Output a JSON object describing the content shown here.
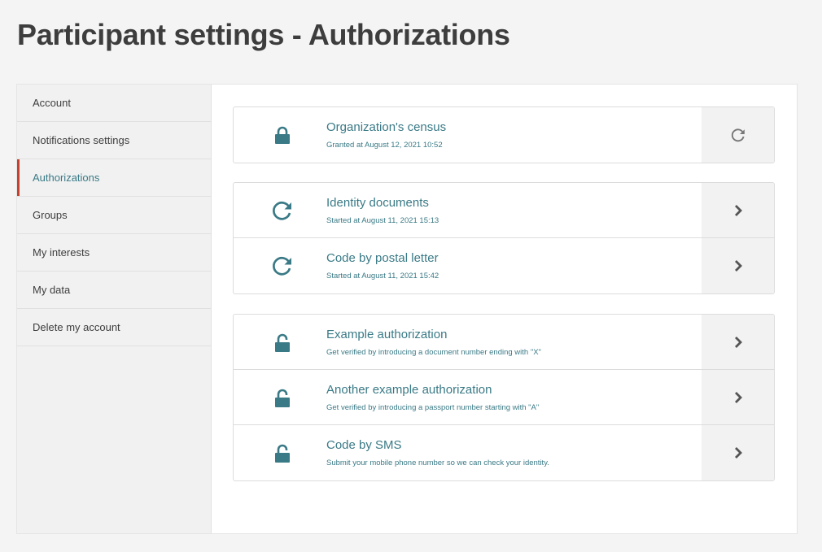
{
  "page": {
    "title": "Participant settings - Authorizations"
  },
  "sidebar": {
    "items": [
      {
        "label": "Account"
      },
      {
        "label": "Notifications settings"
      },
      {
        "label": "Authorizations",
        "active": true
      },
      {
        "label": "Groups"
      },
      {
        "label": "My interests"
      },
      {
        "label": "My data"
      },
      {
        "label": "Delete my account"
      }
    ]
  },
  "granted": [
    {
      "icon": "lock-closed-icon",
      "title": "Organization's census",
      "subtitle": "Granted at August 12, 2021 10:52",
      "action_icon": "refresh-icon"
    }
  ],
  "pending": [
    {
      "icon": "refresh-icon",
      "title": "Identity documents",
      "subtitle": "Started at August 11, 2021 15:13",
      "action_icon": "chevron-right-icon"
    },
    {
      "icon": "refresh-icon",
      "title": "Code by postal letter",
      "subtitle": "Started at August 11, 2021 15:42",
      "action_icon": "chevron-right-icon"
    }
  ],
  "available": [
    {
      "icon": "lock-open-icon",
      "title": "Example authorization",
      "subtitle": "Get verified by introducing a document number ending with \"X\"",
      "action_icon": "chevron-right-icon"
    },
    {
      "icon": "lock-open-icon",
      "title": "Another example authorization",
      "subtitle": "Get verified by introducing a passport number starting with \"A\"",
      "action_icon": "chevron-right-icon"
    },
    {
      "icon": "lock-open-icon",
      "title": "Code by SMS",
      "subtitle": "Submit your mobile phone number so we can check your identity.",
      "action_icon": "chevron-right-icon"
    }
  ],
  "colors": {
    "accent": "#3a7a86",
    "active_marker": "#c5432e",
    "action_icon": "#555555",
    "action_refresh": "#777777"
  }
}
